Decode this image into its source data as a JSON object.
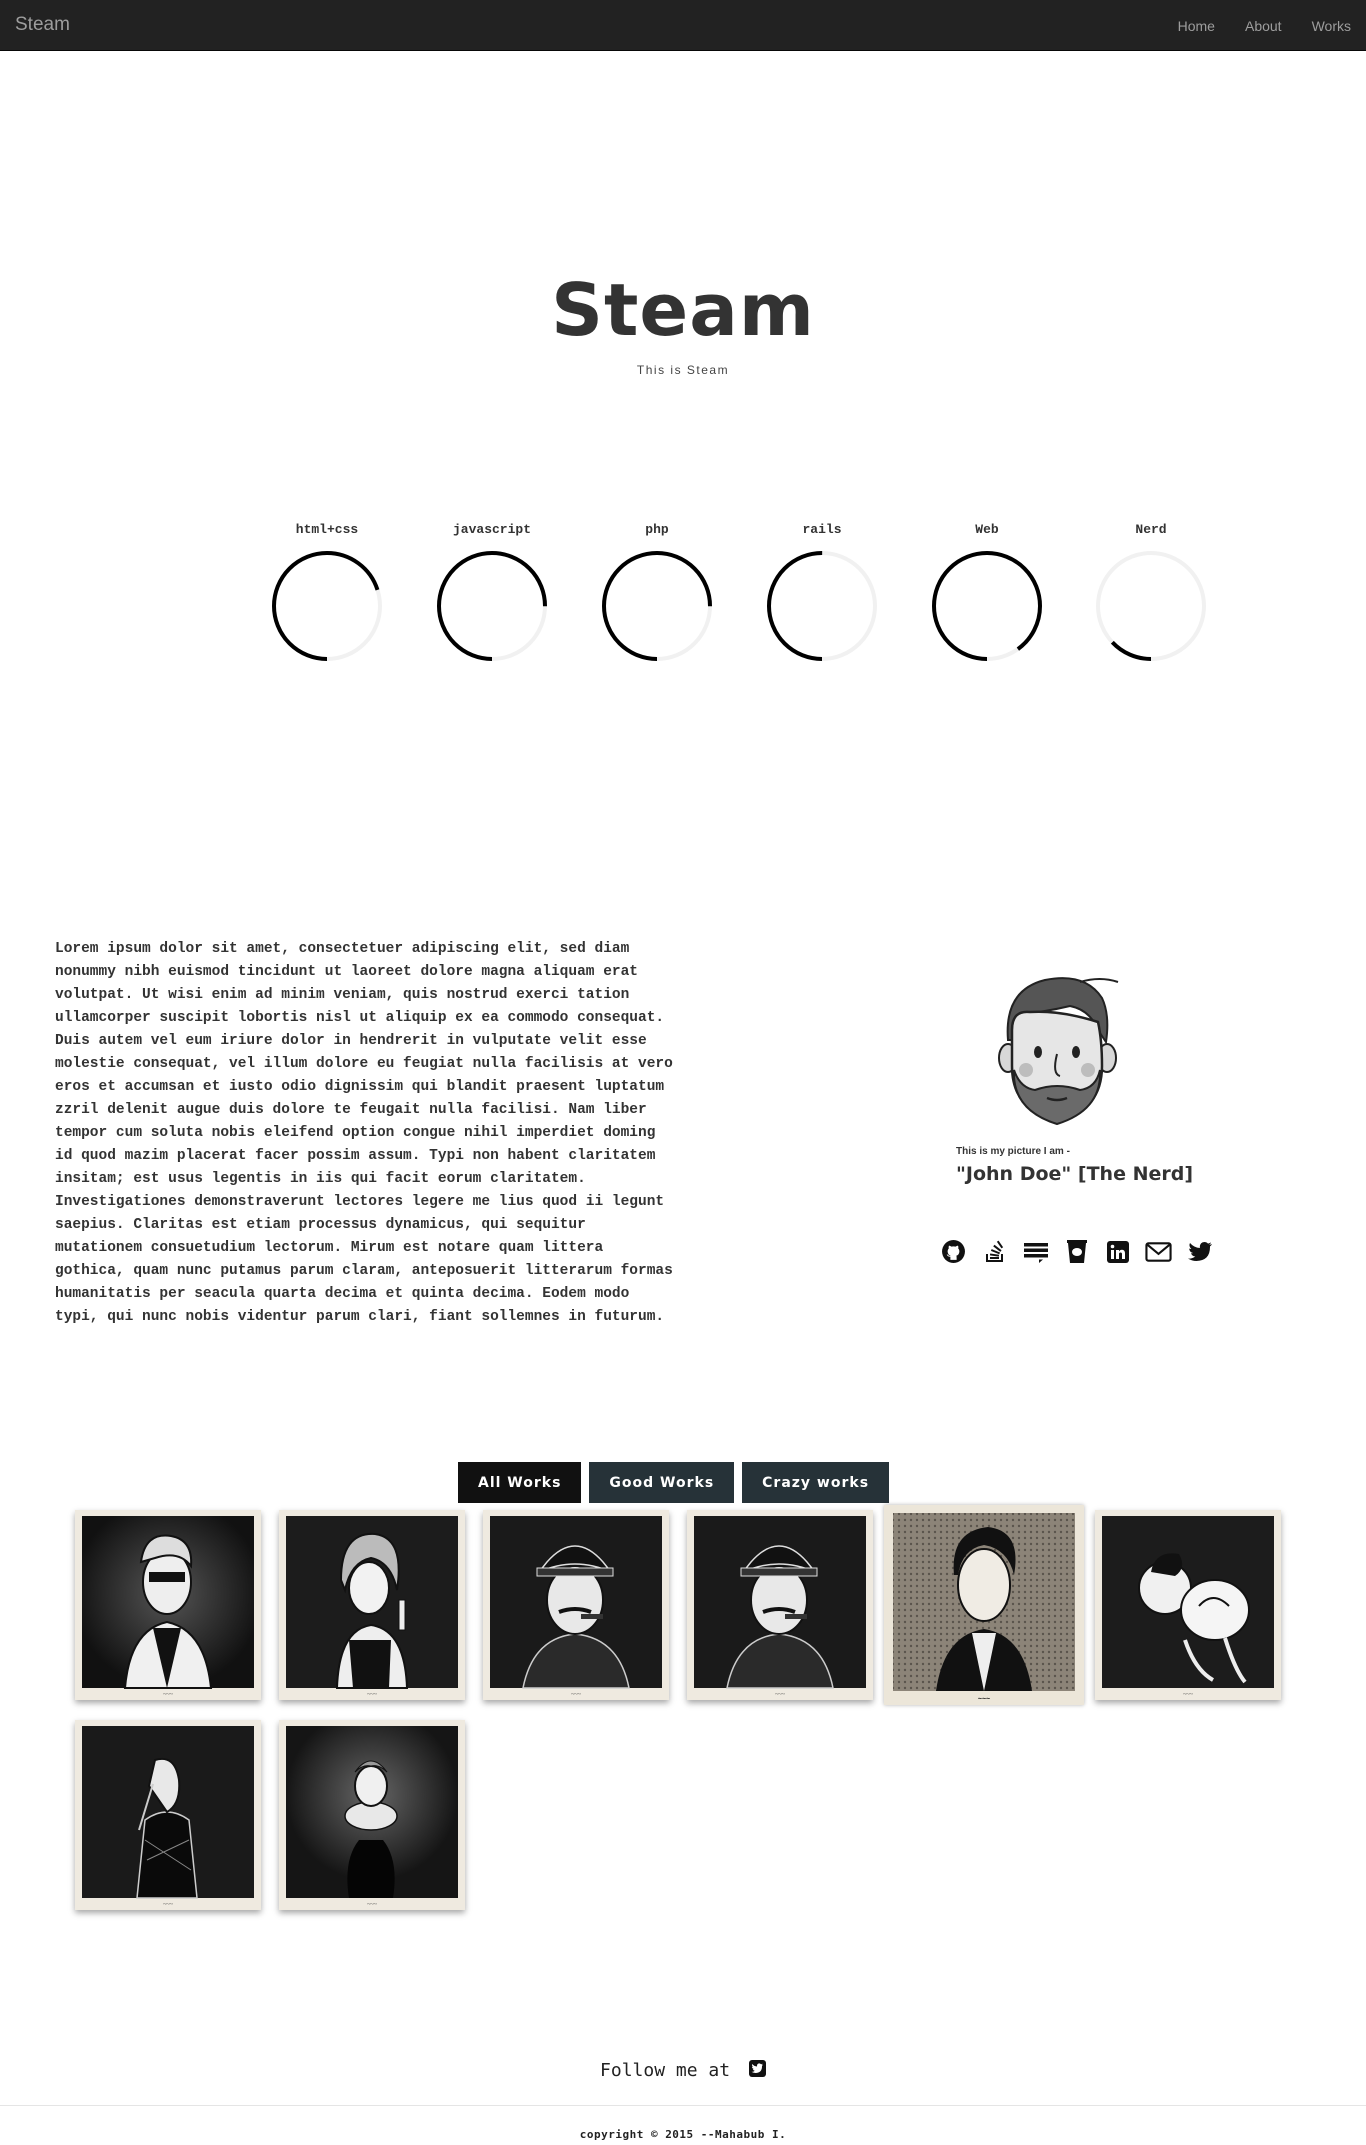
{
  "navbar": {
    "brand": "Steam",
    "links": [
      {
        "label": "Home"
      },
      {
        "label": "About"
      },
      {
        "label": "Works"
      }
    ]
  },
  "hero": {
    "title": "Steam",
    "subtitle": "This is Steam"
  },
  "skills": [
    {
      "label": "html+css",
      "percent": 70
    },
    {
      "label": "javascript",
      "percent": 75
    },
    {
      "label": "php",
      "percent": 75
    },
    {
      "label": "rails",
      "percent": 50
    },
    {
      "label": "Web",
      "percent": 90
    },
    {
      "label": "Nerd",
      "percent": 13
    }
  ],
  "about": {
    "text": "Lorem ipsum dolor sit amet, consectetuer adipiscing elit, sed diam nonummy nibh euismod tincidunt ut laoreet dolore magna aliquam erat volutpat. Ut wisi enim ad minim veniam, quis nostrud exerci tation ullamcorper suscipit lobortis nisl ut aliquip ex ea commodo consequat. Duis autem vel eum iriure dolor in hendrerit in vulputate velit esse molestie consequat, vel illum dolore eu feugiat nulla facilisis at vero eros et accumsan et iusto odio dignissim qui blandit praesent luptatum zzril delenit augue duis dolore te feugait nulla facilisi. Nam liber tempor cum soluta nobis eleifend option congue nihil imperdiet doming id quod mazim placerat facer possim assum. Typi non habent claritatem insitam; est usus legentis in iis qui facit eorum claritatem. Investigationes demonstraverunt lectores legere me lius quod ii legunt saepius. Claritas est etiam processus dynamicus, qui sequitur mutationem consuetudium lectorum. Mirum est notare quam littera gothica, quam nunc putamus parum claram, anteposuerit litterarum formas humanitatis per seacula quarta decima et quinta decima. Eodem modo typi, qui nunc nobis videntur parum clari, fiant sollemnes in futurum."
  },
  "profile": {
    "caption": "This is my picture I am -",
    "name": "\"John Doe\" [The Nerd]",
    "socials": [
      "github-icon",
      "stackoverflow-icon",
      "stackexchange-icon",
      "coffee-icon",
      "linkedin-icon",
      "envelope-icon",
      "twitter-icon"
    ]
  },
  "works": {
    "filters": [
      {
        "label": "All Works",
        "active": true
      },
      {
        "label": "Good Works",
        "active": false
      },
      {
        "label": "Crazy works",
        "active": false
      }
    ]
  },
  "footer": {
    "follow": "Follow me at",
    "follow_icon": "twitter-square-icon",
    "copyright": "copyright © 2015 --Mahabub I."
  }
}
